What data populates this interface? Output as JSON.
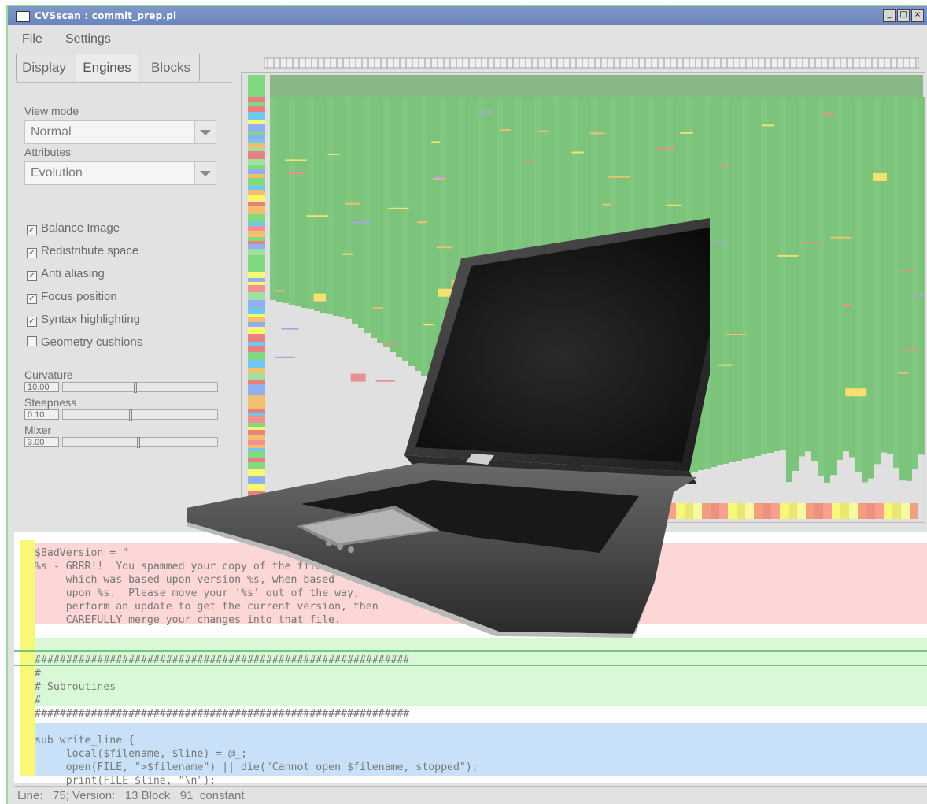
{
  "window": {
    "title": "CVSscan : commit_prep.pl"
  },
  "menu": [
    "File",
    "Settings"
  ],
  "tabs": [
    "Display",
    "Engines",
    "Blocks"
  ],
  "panel": {
    "view_mode_label": "View mode",
    "view_mode_value": "Normal",
    "attributes_label": "Attributes",
    "attributes_value": "Evolution",
    "checkboxes": [
      {
        "label": "Balance Image",
        "checked": true
      },
      {
        "label": "Redistribute space",
        "checked": true
      },
      {
        "label": "Anti aliasing",
        "checked": true
      },
      {
        "label": "Focus position",
        "checked": true
      },
      {
        "label": "Syntax highlighting",
        "checked": true
      },
      {
        "label": "Geometry cushions",
        "checked": false
      }
    ],
    "sliders": [
      {
        "label": "Curvature",
        "value": "10.00"
      },
      {
        "label": "Steepness",
        "value": "0.10"
      },
      {
        "label": "Mixer",
        "value": "3.00"
      }
    ]
  },
  "code_lines": [
    "$BadVersion = \"",
    "%s - GRRR!!  You spammed your copy of the file",
    "     which was based upon version %s, when based",
    "     upon %s.  Please move your '%s' out of the way,",
    "     perform an update to get the current version, then",
    "     CAREFULLY merge your changes into that file.",
    "",
    "",
    "############################################################",
    "#",
    "# Subroutines",
    "#",
    "############################################################",
    "",
    "sub write_line {",
    "     local($filename, $line) = @_;",
    "     open(FILE, \">$filename\") || die(\"Cannot open $filename, stopped\");",
    "     print(FILE $line, \"\\n\");"
  ],
  "status": {
    "text": "Line:   75; Version:   13 Block   91  constant"
  },
  "colors": {
    "title_bar": "#6a85bd",
    "evolution_green": "#7cc47c",
    "removed_pink": "#fdd6d6",
    "comment_green": "#d8f8d8",
    "sub_blue": "#c8e0f8",
    "gutter_yellow": "#f8f878"
  }
}
